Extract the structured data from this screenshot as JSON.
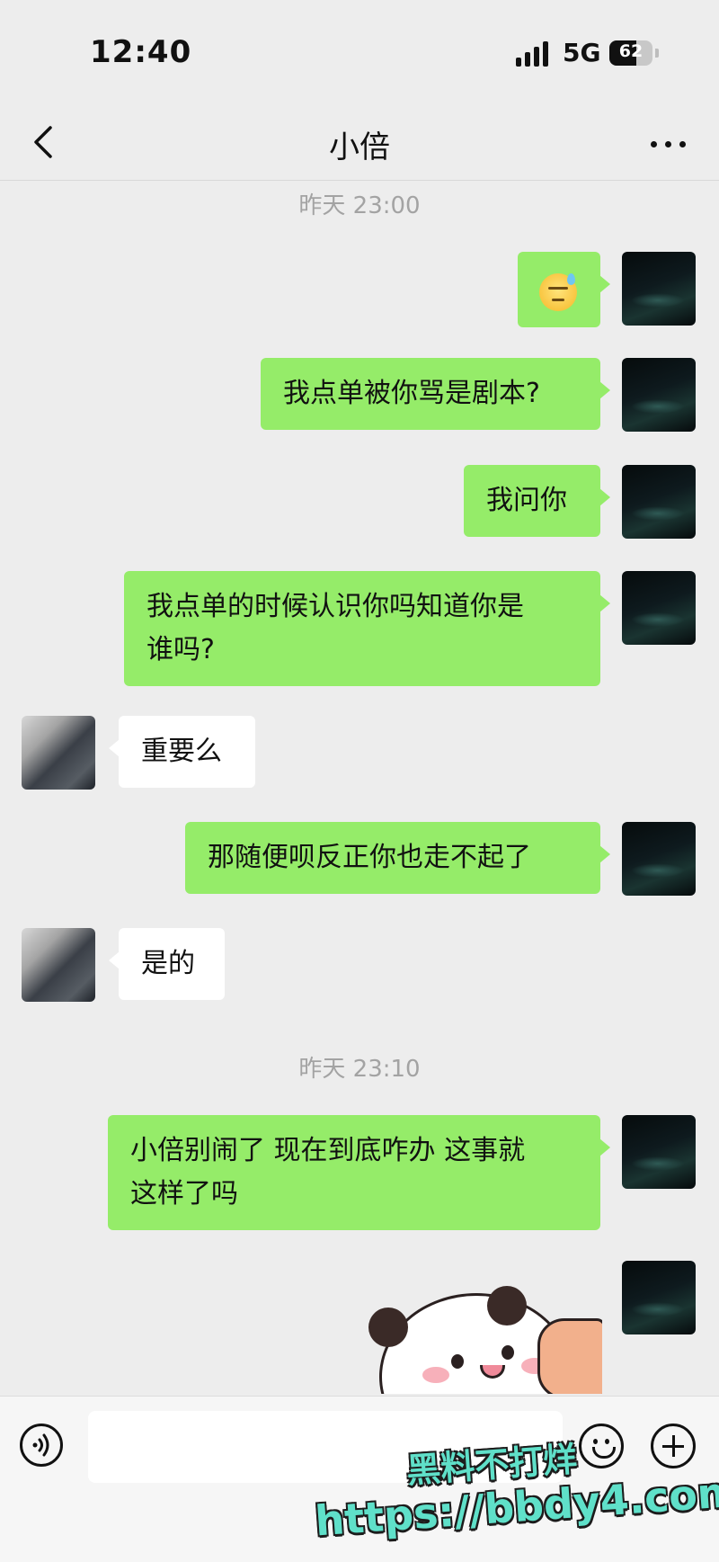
{
  "status_bar": {
    "time": "12:40",
    "network": "5G",
    "battery": "62",
    "battery_level": 0.62
  },
  "nav": {
    "title": "小倍"
  },
  "timestamps": [
    "昨天 23:00",
    "昨天 23:10"
  ],
  "messages": {
    "m2": "我点单被你骂是剧本?",
    "m3": "我问你",
    "m4_line1": "我点单的时候认识你吗知道你是",
    "m4_line2": "谁吗?",
    "m5": "重要么",
    "m6": "那随便呗反正你也走不起了",
    "m7": "是的",
    "m8_line1": "小倍别闹了 现在到底咋办 这事就",
    "m8_line2": "这样了吗"
  },
  "icons": {
    "back": "chevron-left-icon",
    "more": "more-icon",
    "emoji_msg": "sweat-smile-emoji",
    "voice": "voice-icon",
    "emoji": "emoji-icon",
    "plus": "plus-icon"
  },
  "colors": {
    "bubble_me": "#95ec69",
    "bubble_other": "#ffffff",
    "background": "#ededed"
  },
  "watermark": {
    "line1": "黑料不打烊",
    "line2": "https://bbdy4.com"
  }
}
